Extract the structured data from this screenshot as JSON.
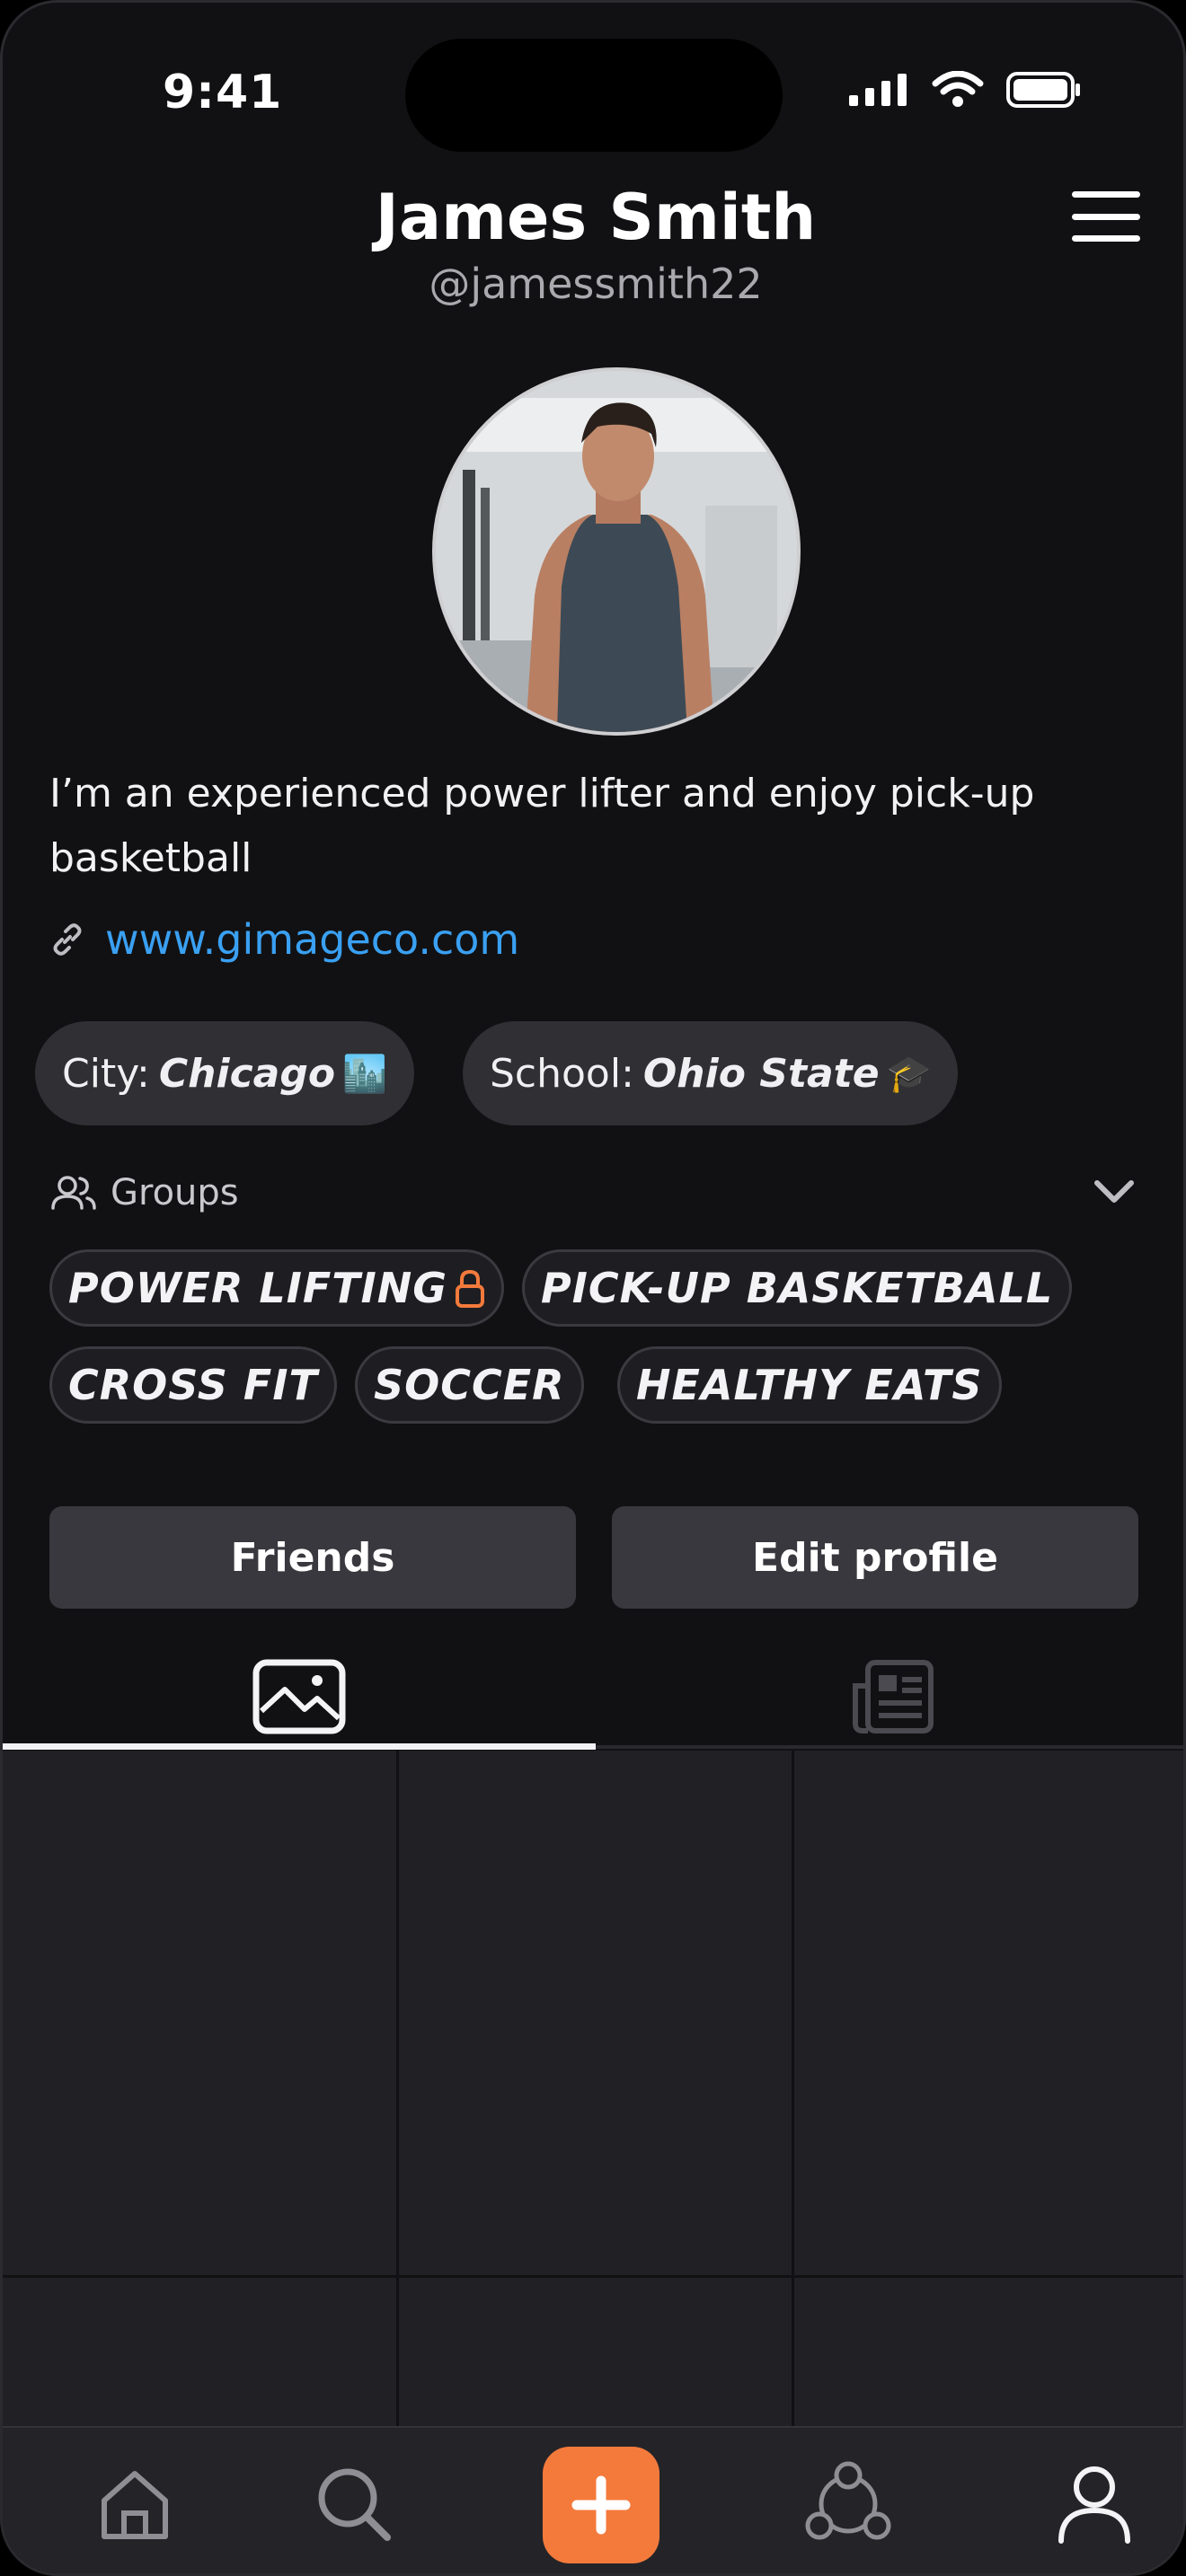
{
  "status_bar": {
    "time": "9:41"
  },
  "profile": {
    "name": "James Smith",
    "handle": "@jamessmith22",
    "bio": "I’m an experienced power lifter and enjoy pick-up basketball",
    "website": "www.gimageco.com"
  },
  "chips": {
    "city_label": "City:",
    "city_value": "Chicago",
    "city_emoji": "🏙️",
    "school_label": "School:",
    "school_value": "Ohio State",
    "school_emoji": "🎓"
  },
  "groups": {
    "label": "Groups",
    "tags": [
      "POWER LIFTING",
      "PICK-UP BASKETBALL",
      "CROSS FIT",
      "SOCCER",
      "HEALTHY EATS"
    ]
  },
  "actions": {
    "friends": "Friends",
    "edit_profile": "Edit profile"
  },
  "tabs": {
    "active": "photos",
    "items": [
      "photos-icon",
      "posts-icon"
    ]
  },
  "nav": {
    "items": [
      "home-icon",
      "search-icon",
      "plus-icon",
      "groups-icon",
      "profile-icon"
    ]
  },
  "colors": {
    "accent": "#f47a3c",
    "link": "#3aa0f2",
    "lock": "#f47a3c",
    "background": "#111113"
  }
}
